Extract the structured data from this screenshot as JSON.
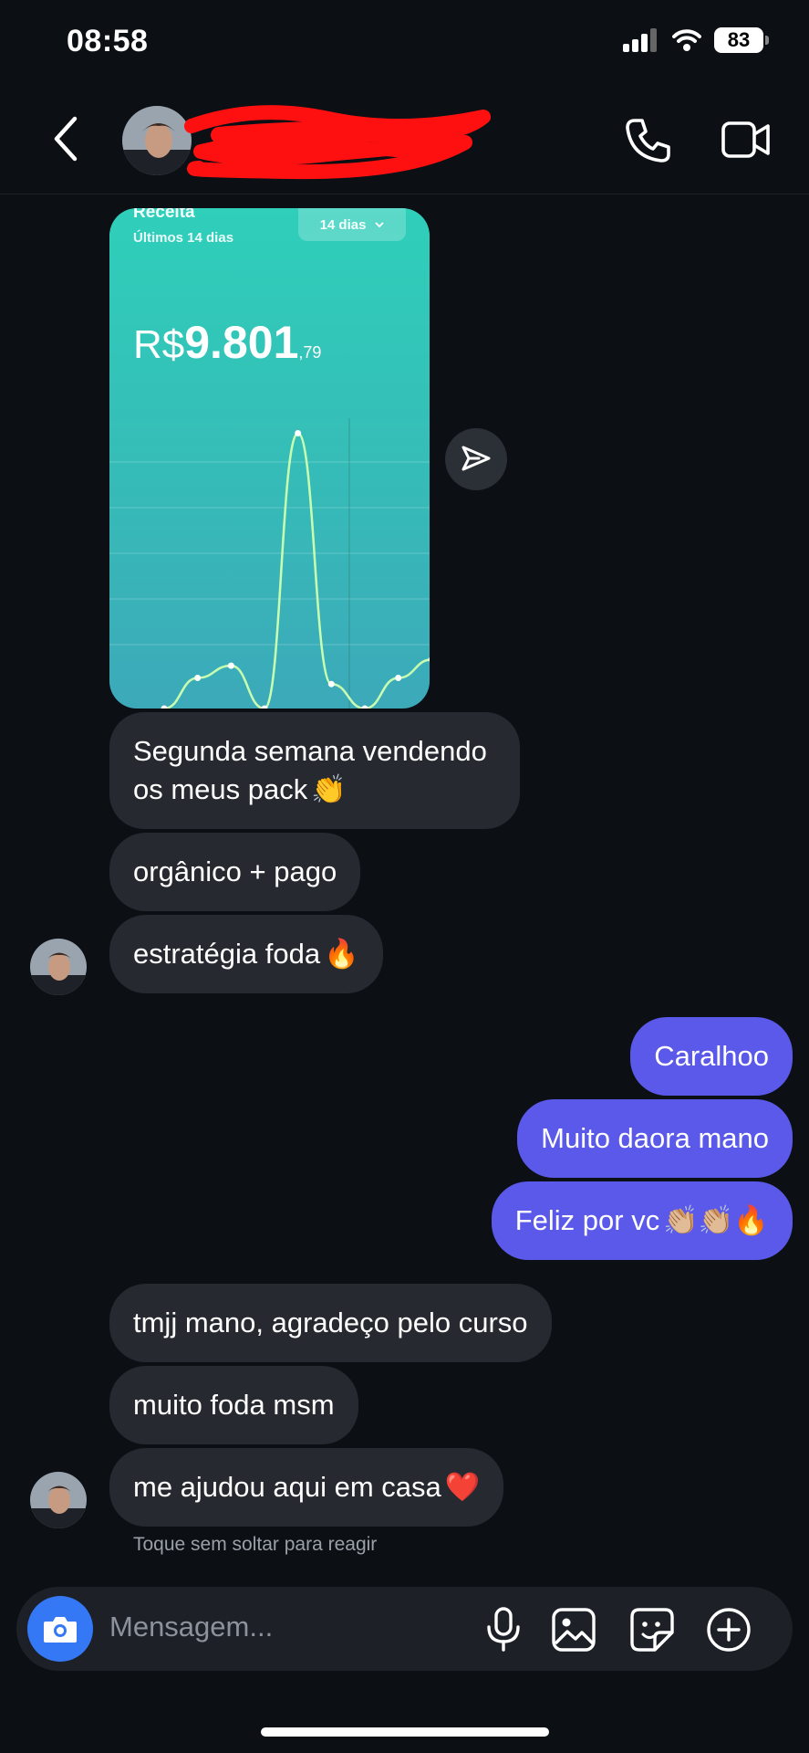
{
  "status_bar": {
    "time": "08:58",
    "battery": "83"
  },
  "header": {
    "contact_name": ""
  },
  "shared_post": {
    "title": "Receita",
    "subtitle": "Últimos 14 dias",
    "period_dropdown": "14 dias",
    "currency": "R$",
    "amount_main": "9.801",
    "amount_cents": ",79",
    "chart_data": {
      "type": "line",
      "values": [
        0.0,
        0.05,
        0.07,
        0.0,
        0.45,
        0.04,
        0.0,
        0.05,
        0.08,
        0.03
      ]
    }
  },
  "messages": [
    {
      "id": "m1",
      "direction": "incoming",
      "text": "Segunda semana vendendo os meus pack",
      "emoji": "👏"
    },
    {
      "id": "m2",
      "direction": "incoming",
      "text": "orgânico + pago",
      "emoji": ""
    },
    {
      "id": "m3",
      "direction": "incoming",
      "text": "estratégia foda",
      "emoji": "🔥"
    },
    {
      "id": "m4",
      "direction": "outgoing",
      "text": "Caralhoo",
      "emoji": ""
    },
    {
      "id": "m5",
      "direction": "outgoing",
      "text": "Muito daora mano",
      "emoji": ""
    },
    {
      "id": "m6",
      "direction": "outgoing",
      "text": "Feliz por vc",
      "emoji": "👏🏼👏🏼🔥"
    },
    {
      "id": "m7",
      "direction": "incoming",
      "text": "tmjj mano, agradeço pelo curso",
      "emoji": ""
    },
    {
      "id": "m8",
      "direction": "incoming",
      "text": "muito foda msm",
      "emoji": ""
    },
    {
      "id": "m9",
      "direction": "incoming",
      "text": "me ajudou aqui em casa",
      "emoji": "❤️"
    }
  ],
  "reaction_hint": "Toque sem soltar para reagir",
  "composer": {
    "placeholder": "Mensagem..."
  },
  "colors": {
    "background": "#0c0f14",
    "incoming_bubble": "#262930",
    "outgoing_bubble": "#5a59ea",
    "camera_button": "#3478f6"
  },
  "icons": [
    "back-icon",
    "phone-icon",
    "video-icon",
    "send-icon",
    "camera-icon",
    "microphone-icon",
    "gallery-icon",
    "sticker-icon",
    "plus-icon"
  ]
}
